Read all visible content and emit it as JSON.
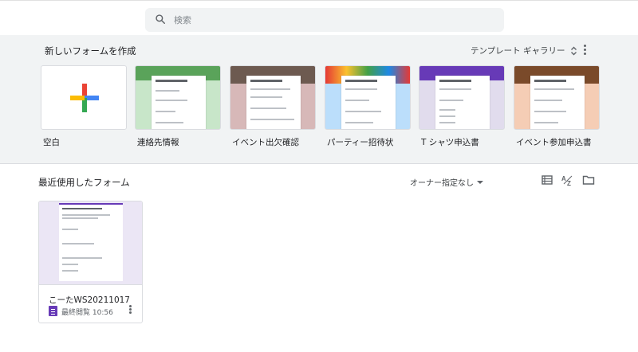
{
  "search": {
    "placeholder": "検索"
  },
  "templates": {
    "title": "新しいフォームを作成",
    "gallery_label": "テンプレート ギャラリー",
    "items": [
      {
        "label": "空白",
        "color": "#ffffff"
      },
      {
        "label": "連絡先情報",
        "color": "#c8e6c9"
      },
      {
        "label": "イベント出欠確認",
        "color": "#d7b8b8"
      },
      {
        "label": "パーティー招待状",
        "color": "#bbdefb"
      },
      {
        "label": "T シャツ申込書",
        "color": "#e1dced"
      },
      {
        "label": "イベント参加申込書",
        "color": "#f5cdb5"
      }
    ]
  },
  "recent": {
    "title": "最近使用したフォーム",
    "owner_filter": "オーナー指定なし",
    "docs": [
      {
        "name": "こーたWS20211017",
        "meta": "最終閲覧 10:56"
      }
    ]
  },
  "colors": {
    "forms_purple": "#673ab7"
  }
}
